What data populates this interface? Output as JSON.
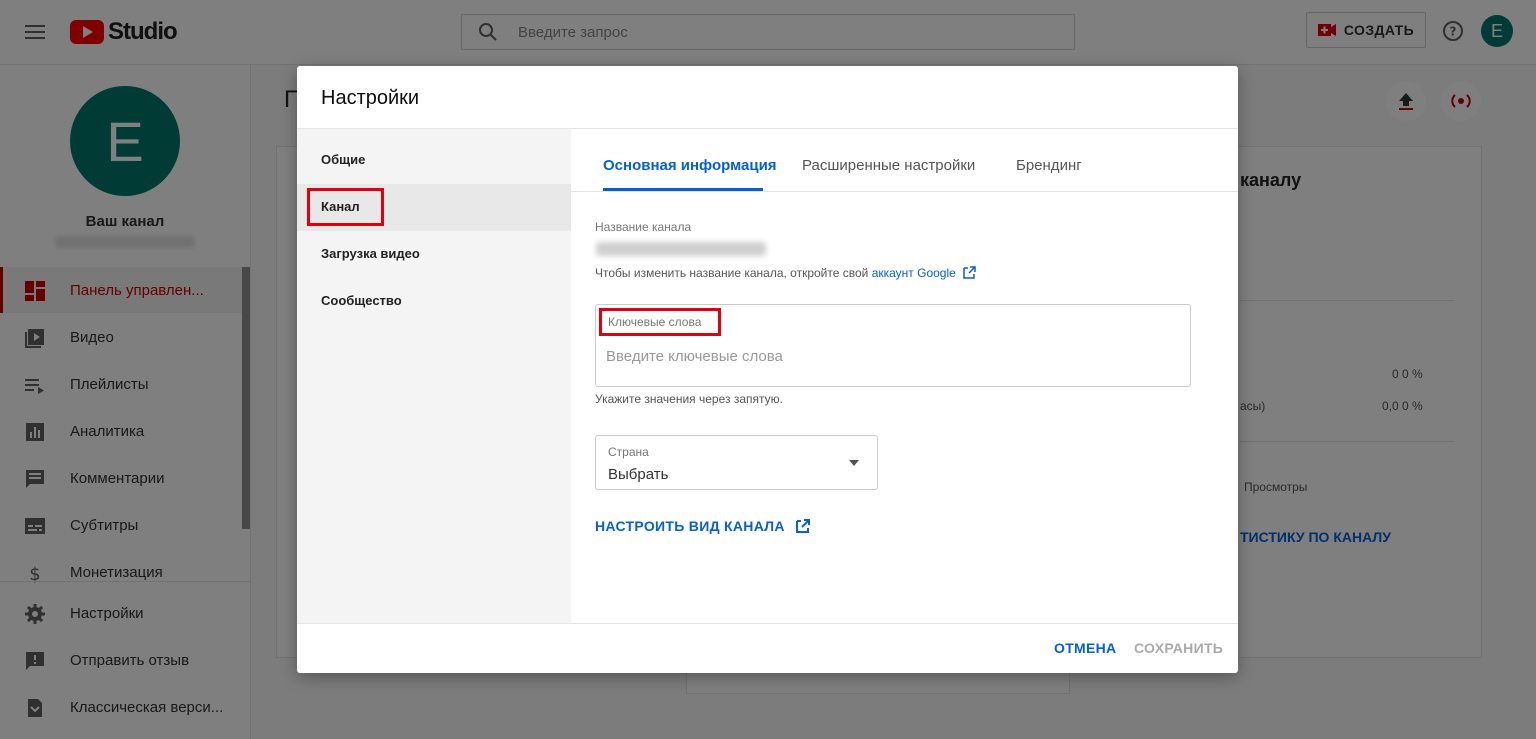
{
  "app": {
    "logo_text": "Studio",
    "search_placeholder": "Введите запрос",
    "create_label": "СОЗДАТЬ",
    "avatar_letter": "E"
  },
  "sidebar": {
    "avatar_letter": "E",
    "channel_label": "Ваш канал",
    "items": [
      {
        "label": "Панель управлен...",
        "icon": "dashboard-icon",
        "active": true
      },
      {
        "label": "Видео",
        "icon": "video-icon"
      },
      {
        "label": "Плейлисты",
        "icon": "playlist-icon"
      },
      {
        "label": "Аналитика",
        "icon": "analytics-icon"
      },
      {
        "label": "Комментарии",
        "icon": "comments-icon"
      },
      {
        "label": "Субтитры",
        "icon": "subtitles-icon"
      },
      {
        "label": "Монетизация",
        "icon": "dollar-icon"
      }
    ],
    "bottom_items": [
      {
        "label": "Настройки",
        "icon": "gear-icon"
      },
      {
        "label": "Отправить отзыв",
        "icon": "feedback-icon"
      },
      {
        "label": "Классическая верси...",
        "icon": "classic-icon"
      }
    ]
  },
  "background": {
    "page_title_initial": "П",
    "card_title": "каналу",
    "stat_1": "0 0 %",
    "stat_2_label": "асы)",
    "stat_2": "0,0 0 %",
    "views_label": "Просмотры",
    "link": "ТИСТИКУ ПО КАНАЛУ"
  },
  "dialog": {
    "title": "Настройки",
    "nav": [
      {
        "label": "Общие"
      },
      {
        "label": "Канал",
        "active": true
      },
      {
        "label": "Загрузка видео"
      },
      {
        "label": "Сообщество"
      }
    ],
    "tabs": [
      {
        "label": "Основная информация",
        "active": true
      },
      {
        "label": "Расширенные настройки"
      },
      {
        "label": "Брендинг"
      }
    ],
    "channel_name_label": "Название канала",
    "hint_text": "Чтобы изменить название канала, откройте свой ",
    "hint_link": "аккаунт Google",
    "keywords_label": "Ключевые слова",
    "keywords_placeholder": "Введите ключевые слова",
    "keywords_help": "Укажите значения через запятую.",
    "country_label": "Страна",
    "country_value": "Выбрать",
    "customize_link": "НАСТРОИТЬ ВИД КАНАЛА",
    "cancel": "ОТМЕНА",
    "save": "СОХРАНИТЬ"
  },
  "colors": {
    "accent": "#065fd4",
    "brand_red": "#ff0000",
    "avatar": "#00796b",
    "highlight_box": "#e1000f"
  }
}
